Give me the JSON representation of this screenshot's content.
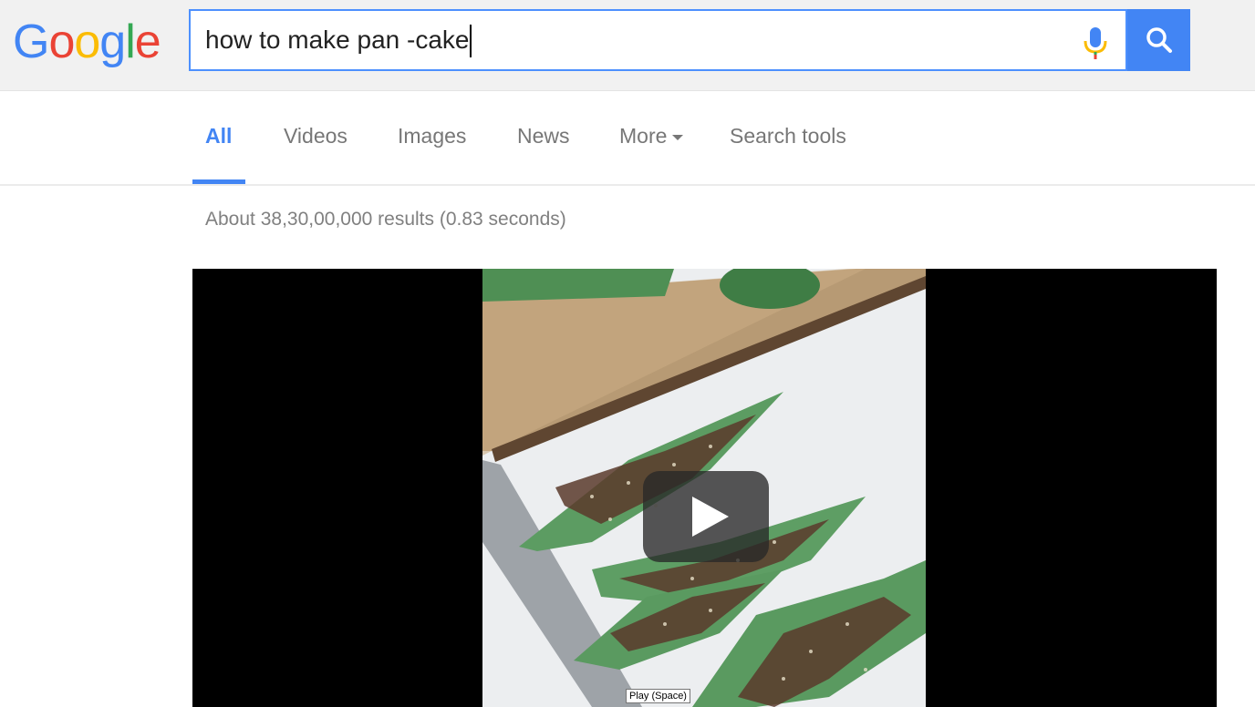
{
  "logo": {
    "letters": [
      "G",
      "o",
      "o",
      "g",
      "l",
      "e"
    ],
    "colors": [
      "#4285f4",
      "#ea4335",
      "#fbbc05",
      "#4285f4",
      "#34a853",
      "#ea4335"
    ]
  },
  "search": {
    "value": "how to make pan -cake"
  },
  "tabs": [
    {
      "label": "All"
    },
    {
      "label": "Videos"
    },
    {
      "label": "Images"
    },
    {
      "label": "News"
    },
    {
      "label": "More"
    },
    {
      "label": "Search tools"
    }
  ],
  "results": {
    "stats": "About 38,30,00,000 results (0.83 seconds)"
  },
  "video": {
    "tooltip": "Play (Space)"
  },
  "colors": {
    "accent": "#4285f4",
    "header_bg": "#f1f1f1"
  }
}
